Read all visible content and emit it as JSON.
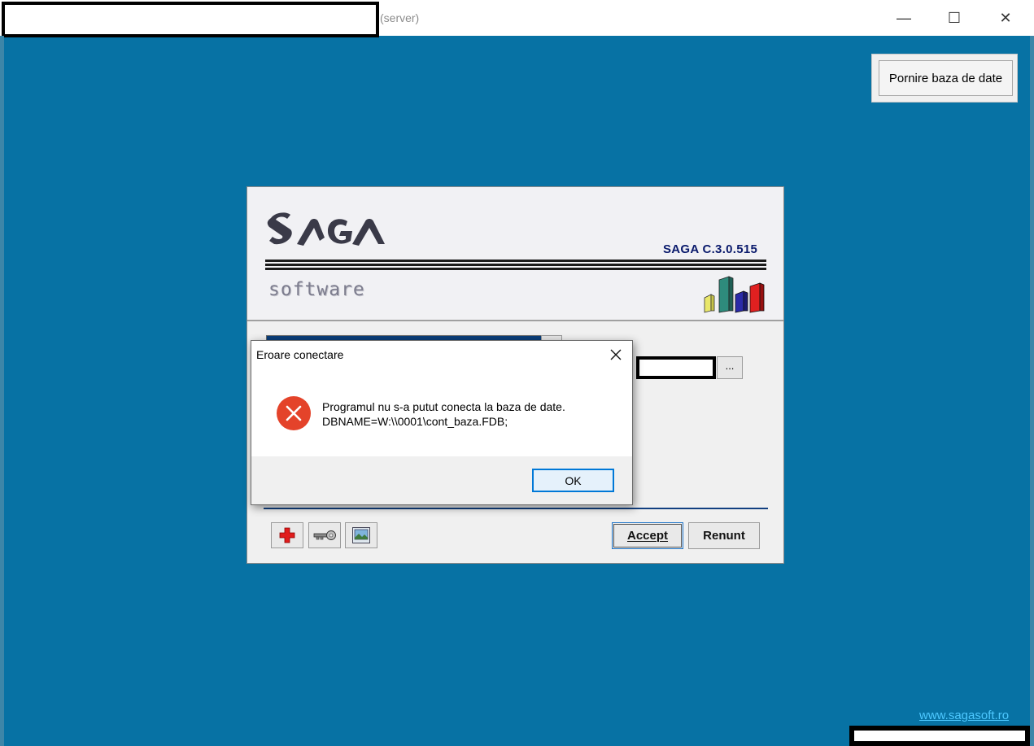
{
  "window": {
    "title_suffix": "(server)",
    "minimize_glyph": "—",
    "maximize_glyph": "☐",
    "close_glyph": "✕"
  },
  "toolbar": {
    "start_db_label": "Pornire baza de date"
  },
  "app": {
    "version": "SAGA C.3.0.515",
    "software_label": "software",
    "browse_label": "...",
    "accept_label": "Accept",
    "renunt_label": "Renunt",
    "website": "www.sagasoft.ro"
  },
  "error_dialog": {
    "title": "Eroare conectare",
    "message_line1": "Programul nu s-a putut conecta la baza de date.",
    "message_line2": "DBNAME=W:\\\\0001\\cont_baza.FDB;",
    "ok_label": "OK"
  },
  "colors": {
    "desktop": "#0772a4",
    "error_icon": "#e4432a",
    "accent": "#0078d7"
  }
}
